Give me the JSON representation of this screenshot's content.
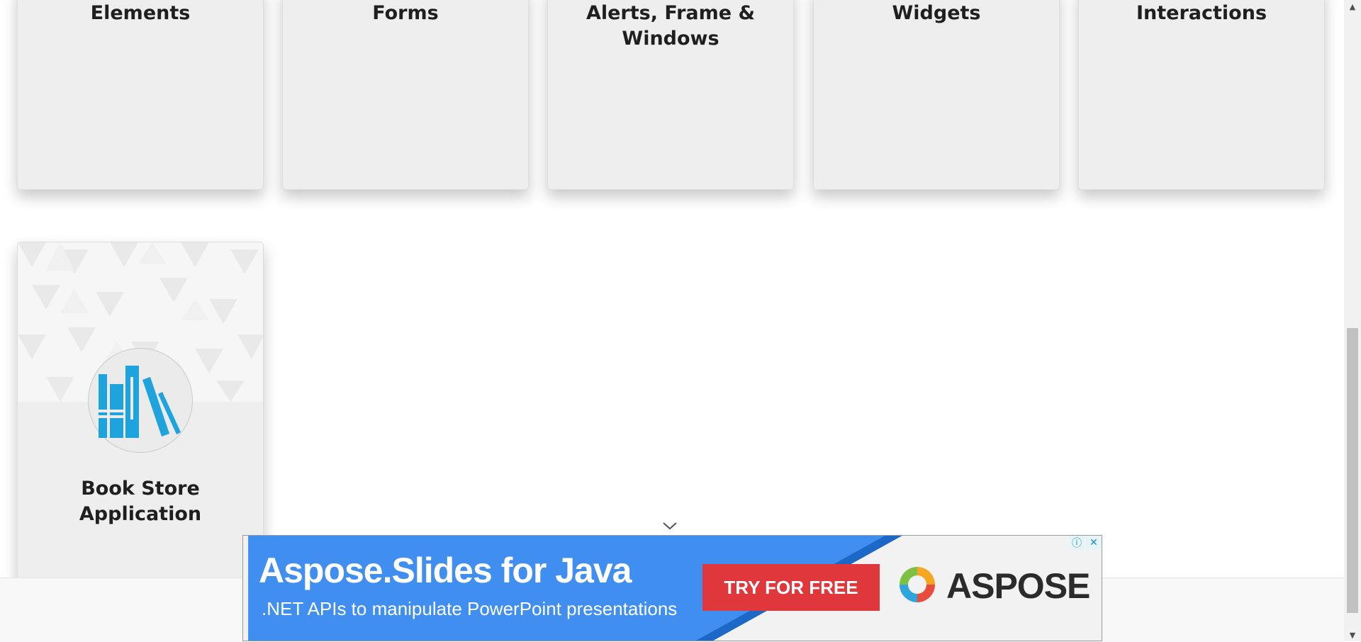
{
  "cards": [
    {
      "title": "Elements"
    },
    {
      "title": "Forms"
    },
    {
      "title": "Alerts, Frame &\nWindows"
    },
    {
      "title": "Widgets"
    },
    {
      "title": "Interactions"
    },
    {
      "title": "Book Store\nApplication"
    }
  ],
  "ad": {
    "headline": "Aspose.Slides for Java",
    "subtext": ".NET APIs to manipulate PowerPoint presentations",
    "cta": "TRY FOR FREE",
    "brand": "ASPOSE",
    "info_icon": "info-icon",
    "close_icon": "close-icon"
  },
  "colors": {
    "card_bg": "#eeeeee",
    "book_icon": "#1ea3dc",
    "ad_blue": "#3f8ef0",
    "cta_red": "#e0373c"
  }
}
